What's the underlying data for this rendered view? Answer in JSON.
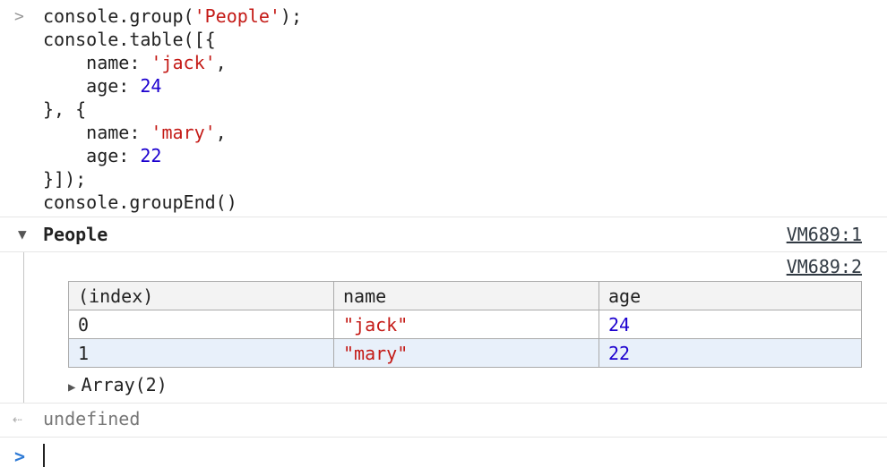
{
  "input_prompt": ">",
  "code_lines": [
    [
      {
        "t": "plain",
        "v": "console.group("
      },
      {
        "t": "str",
        "v": "'People'"
      },
      {
        "t": "plain",
        "v": ");"
      }
    ],
    [
      {
        "t": "plain",
        "v": "console.table([{"
      }
    ],
    [
      {
        "t": "plain",
        "v": "    name: "
      },
      {
        "t": "str",
        "v": "'jack'"
      },
      {
        "t": "plain",
        "v": ","
      }
    ],
    [
      {
        "t": "plain",
        "v": "    age: "
      },
      {
        "t": "num",
        "v": "24"
      }
    ],
    [
      {
        "t": "plain",
        "v": "}, {"
      }
    ],
    [
      {
        "t": "plain",
        "v": "    name: "
      },
      {
        "t": "str",
        "v": "'mary'"
      },
      {
        "t": "plain",
        "v": ","
      }
    ],
    [
      {
        "t": "plain",
        "v": "    age: "
      },
      {
        "t": "num",
        "v": "22"
      }
    ],
    [
      {
        "t": "plain",
        "v": "}]);"
      }
    ],
    [
      {
        "t": "plain",
        "v": "console.groupEnd()"
      }
    ]
  ],
  "group": {
    "title": "People",
    "source_link": "VM689:1",
    "table_source_link": "VM689:2"
  },
  "table": {
    "headers": [
      "(index)",
      "name",
      "age"
    ],
    "rows": [
      {
        "index": "0",
        "name": "\"jack\"",
        "age": "24"
      },
      {
        "index": "1",
        "name": "\"mary\"",
        "age": "22"
      }
    ]
  },
  "array_label": "Array(2)",
  "result_text": "undefined",
  "colors": {
    "string": "#c41a16",
    "number": "#1c00cf",
    "prompt": "#2f7bd6",
    "alt_row": "#e8f0fa"
  }
}
